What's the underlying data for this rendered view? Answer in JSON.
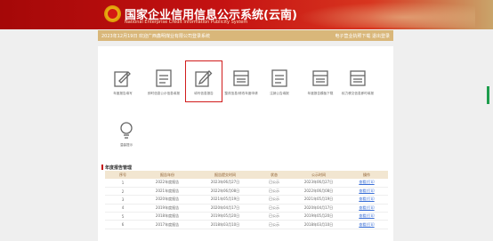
{
  "header": {
    "title": "国家企业信用信息公示系统(云南)",
    "subtitle": "National Enterprise Credit Information Publicity System"
  },
  "infobar": {
    "left": "2023年12月19日   欢迎广西鑫明煤业有限公司登录系统",
    "right": "电子营业执照下载   退出登录"
  },
  "icons": [
    {
      "label": "年度报告填写",
      "icon": "report-edit-icon"
    },
    {
      "label": "即时信息公示信息填报",
      "icon": "document-list-icon"
    },
    {
      "label": "填写信息报告",
      "icon": "edit-pen-icon",
      "selected": true
    },
    {
      "label": "整改信息/修改年度申请",
      "icon": "document-lines-icon"
    },
    {
      "label": "注销公告填报",
      "icon": "document-list-icon"
    },
    {
      "label": "年度报告模板下载",
      "icon": "document-lines-icon"
    },
    {
      "label": "权力移交信息即时填报",
      "icon": "document-lines-icon"
    },
    {
      "label": "温馨提示",
      "icon": "lightbulb-icon"
    }
  ],
  "section": {
    "title": "年度报告管理"
  },
  "table": {
    "headers": [
      "序号",
      "报告年份",
      "报告提交时间",
      "状态",
      "公示时间",
      "操作"
    ],
    "rows": [
      [
        "1",
        "2022年度报告",
        "2023年06月27日",
        "已公示",
        "2023年06月27日",
        "查看|打印"
      ],
      [
        "2",
        "2021年度报告",
        "2022年06月08日",
        "已公示",
        "2022年06月08日",
        "查看|打印"
      ],
      [
        "3",
        "2020年度报告",
        "2021年05月19日",
        "已公示",
        "2021年05月19日",
        "查看|打印"
      ],
      [
        "4",
        "2019年度报告",
        "2020年04月17日",
        "已公示",
        "2020年04月17日",
        "查看|打印"
      ],
      [
        "5",
        "2018年度报告",
        "2019年05月20日",
        "已公示",
        "2019年05月20日",
        "查看|打印"
      ],
      [
        "6",
        "2017年度报告",
        "2018年03月10日",
        "已公示",
        "2018年03月10日",
        "查看|打印"
      ]
    ]
  }
}
